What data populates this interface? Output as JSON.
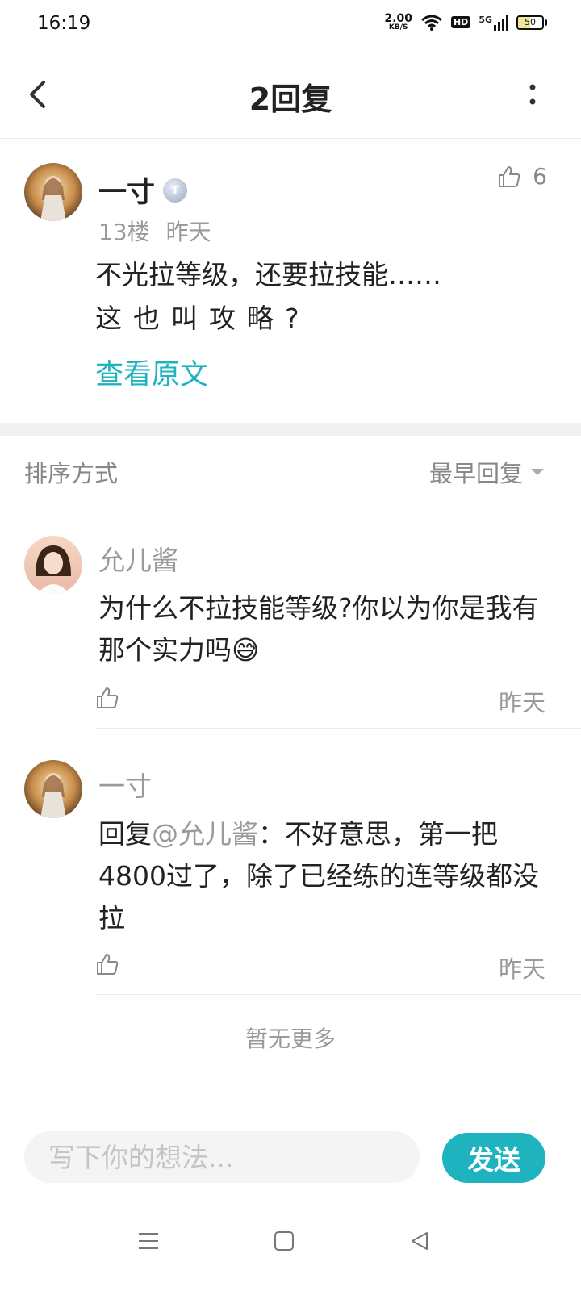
{
  "status_bar": {
    "time": "16:19",
    "net_speed_value": "2.00",
    "net_speed_unit": "KB/S",
    "hd": "HD",
    "signal": "5G",
    "battery": "50",
    "battery_level": 0.5
  },
  "header": {
    "title": "2回复",
    "back_icon": "chevron-left-icon",
    "more_icon": "more-vertical-icon"
  },
  "main_post": {
    "author": "一寸",
    "level_badge": "T",
    "floor": "13楼",
    "time": "昨天",
    "likes": "6",
    "content_line1": "不光拉等级，还要拉技能……",
    "content_line2": "这也叫攻略?",
    "view_original": "查看原文"
  },
  "sort": {
    "label": "排序方式",
    "selected": "最早回复"
  },
  "replies": [
    {
      "author": "允儿酱",
      "text": "为什么不拉技能等级?你以为你是我有那个实力吗",
      "emoji": "😅",
      "time": "昨天"
    },
    {
      "author": "一寸",
      "reply_prefix": "回复",
      "mention": "@允儿酱",
      "text": "：不好意思，第一把4800过了，除了已经练的连等级都没拉",
      "time": "昨天"
    }
  ],
  "no_more": "暂无更多",
  "composer": {
    "placeholder": "写下你的想法...",
    "send_label": "发送"
  },
  "colors": {
    "accent": "#1fb3c0",
    "muted_text": "#9a9a9a",
    "primary_text": "#222222"
  }
}
